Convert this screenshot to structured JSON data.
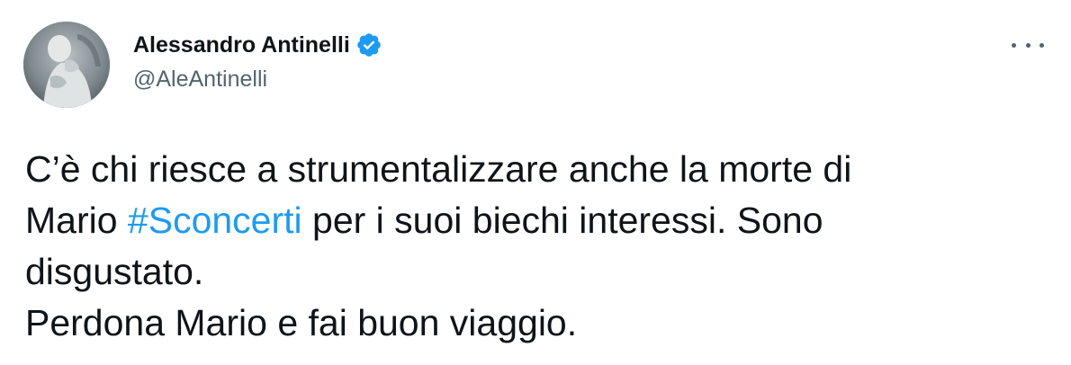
{
  "author": {
    "display_name": "Alessandro Antinelli",
    "handle": "@AleAntinelli",
    "verified": true,
    "avatar_icon": "profile-photo"
  },
  "more_icon": "more-horizontal-icon",
  "tweet": {
    "line1": "C’è chi riesce a strumentalizzare anche la morte di",
    "line2_before": "Mario ",
    "hashtag": "#Sconcerti",
    "line2_after": " per i suoi biechi interessi. Sono",
    "line3": "disgustato.",
    "line4": "Perdona Mario e fai buon viaggio."
  },
  "colors": {
    "text": "#0f1419",
    "secondary": "#536471",
    "accent": "#1d9bf0"
  }
}
